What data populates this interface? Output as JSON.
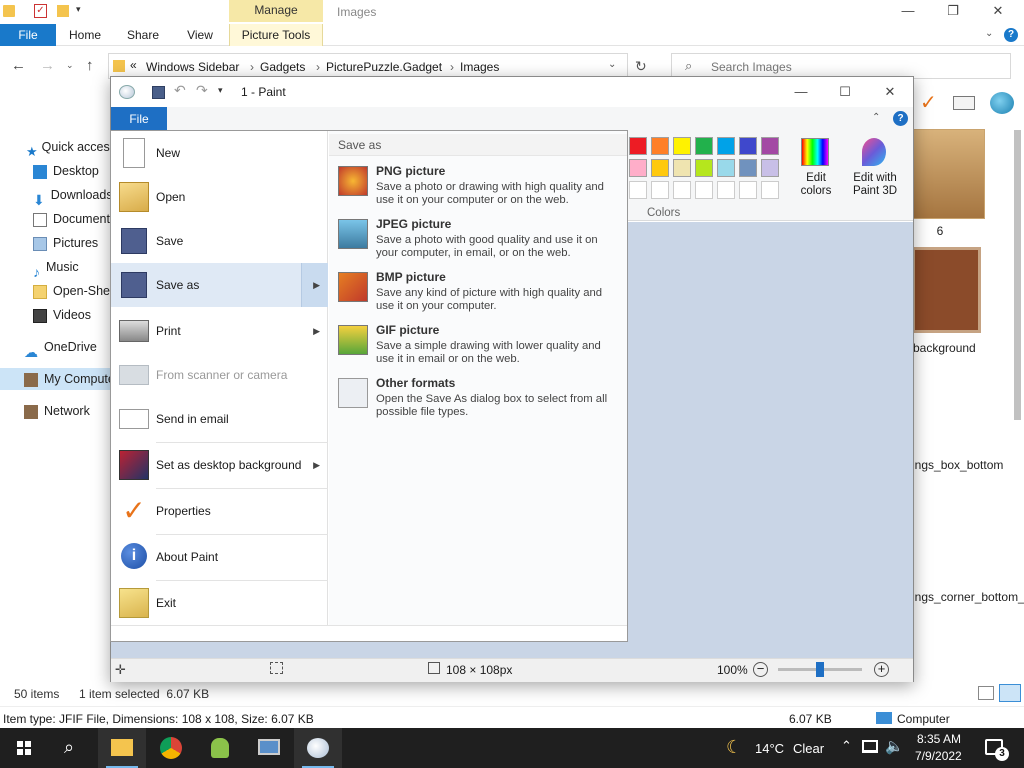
{
  "explorer": {
    "title": "Images",
    "manage_label": "Manage",
    "tabs": [
      "File",
      "Home",
      "Share",
      "View",
      "Picture Tools"
    ],
    "address_prefix": "«",
    "breadcrumb": [
      "Windows Sidebar",
      "Gadgets",
      "PicturePuzzle.Gadget",
      "Images"
    ],
    "search_placeholder": "Search Images",
    "nav_items": [
      {
        "label": "Quick access",
        "icon": "star-icon"
      },
      {
        "label": "Desktop",
        "icon": "desktop-icon"
      },
      {
        "label": "Downloads",
        "icon": "download-icon"
      },
      {
        "label": "Documents",
        "icon": "document-icon"
      },
      {
        "label": "Pictures",
        "icon": "pictures-icon"
      },
      {
        "label": "Music",
        "icon": "music-icon"
      },
      {
        "label": "Open-Shell",
        "icon": "folder-icon"
      },
      {
        "label": "Videos",
        "icon": "video-icon"
      },
      {
        "label": "OneDrive",
        "icon": "cloud-icon"
      },
      {
        "label": "My Computer",
        "icon": "computer-icon"
      },
      {
        "label": "Network",
        "icon": "network-icon"
      }
    ],
    "thumb_labels": [
      "6",
      "background",
      "ings_box_bottom",
      "ings_corner_bottom_right"
    ],
    "status_items": "50 items",
    "status_selected": "1 item selected  6.07 KB",
    "details_text": "Item type: JFIF File, Dimensions: 108 x 108, Size: 6.07 KB",
    "details_size": "6.07 KB",
    "details_location": "Computer"
  },
  "paint": {
    "title": "1 - Paint",
    "file_tab": "File",
    "colors_label": "Colors",
    "edit_colors": "Edit colors",
    "edit_paint3d": "Edit with Paint 3D",
    "status_dims": "108 × 108px",
    "zoom": "100%",
    "palette_row1": [
      "#ed1c24",
      "#ff7f27",
      "#fff200",
      "#22b14c",
      "#00a2e8",
      "#3f48cc",
      "#a349a4"
    ],
    "palette_row2": [
      "#ffaec9",
      "#ffc90e",
      "#efe4b0",
      "#b5e61d",
      "#99d9ea",
      "#7092be",
      "#c8bfe7"
    ]
  },
  "file_menu": {
    "items": [
      {
        "label": "New",
        "icon": "new-file-icon",
        "arrow": false,
        "disabled": false
      },
      {
        "label": "Open",
        "icon": "open-folder-icon",
        "arrow": false,
        "disabled": false
      },
      {
        "label": "Save",
        "icon": "save-disk-icon",
        "arrow": false,
        "disabled": false
      },
      {
        "label": "Save as",
        "icon": "save-as-icon",
        "arrow": true,
        "disabled": false
      },
      {
        "label": "Print",
        "icon": "printer-icon",
        "arrow": true,
        "disabled": false
      },
      {
        "label": "From scanner or camera",
        "icon": "scanner-icon",
        "arrow": false,
        "disabled": true
      },
      {
        "label": "Send in email",
        "icon": "email-icon",
        "arrow": false,
        "disabled": false
      },
      {
        "label": "Set as desktop background",
        "icon": "desktop-background-icon",
        "arrow": true,
        "disabled": false
      },
      {
        "label": "Properties",
        "icon": "checkmark-icon",
        "arrow": false,
        "disabled": false
      },
      {
        "label": "About Paint",
        "icon": "info-icon",
        "arrow": false,
        "disabled": false
      },
      {
        "label": "Exit",
        "icon": "exit-icon",
        "arrow": false,
        "disabled": false
      }
    ],
    "save_as_header": "Save as",
    "save_as_options": [
      {
        "title": "PNG picture",
        "desc": "Save a photo or drawing with high quality and use it on your computer or on the web.",
        "icon": "png-icon"
      },
      {
        "title": "JPEG picture",
        "desc": "Save a photo with good quality and use it on your computer, in email, or on the web.",
        "icon": "jpeg-icon"
      },
      {
        "title": "BMP picture",
        "desc": "Save any kind of picture with high quality and use it on your computer.",
        "icon": "bmp-icon"
      },
      {
        "title": "GIF picture",
        "desc": "Save a simple drawing with lower quality and use it in email or on the web.",
        "icon": "gif-icon"
      },
      {
        "title": "Other formats",
        "desc": "Open the Save As dialog box to select from all possible file types.",
        "icon": "other-formats-icon"
      }
    ]
  },
  "taskbar": {
    "weather_temp": "14°C",
    "weather_cond": "Clear",
    "time": "8:35 AM",
    "date": "7/9/2022",
    "notification_count": "3"
  }
}
